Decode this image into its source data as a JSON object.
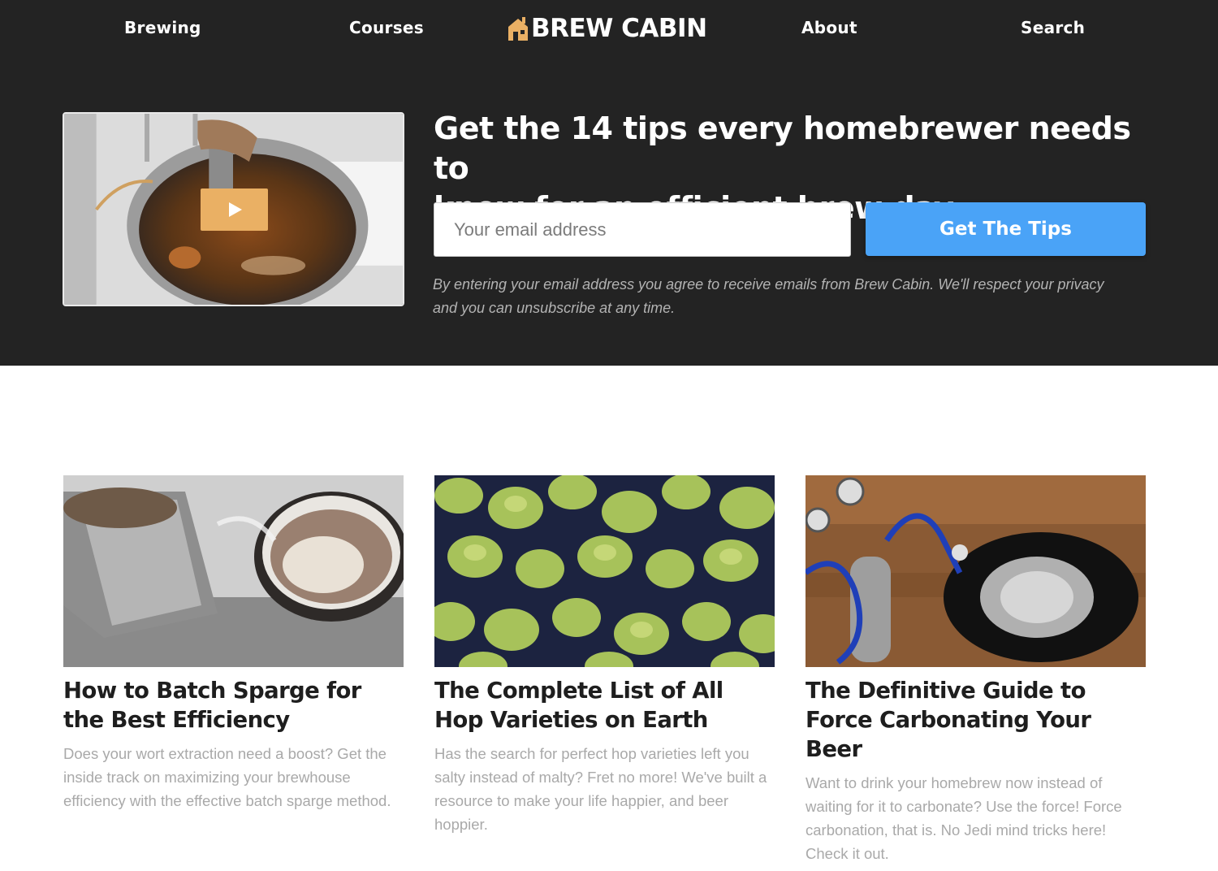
{
  "nav": {
    "links": [
      "Brewing",
      "Courses",
      "About",
      "Search"
    ],
    "logo_text": "BREW CABIN"
  },
  "hero": {
    "headline_line1": "Get the 14 tips every homebrewer needs to",
    "headline_line2": "know for an efficient brew day.",
    "email_placeholder": "Your email address",
    "cta_label": "Get The Tips",
    "disclaimer": "By entering your email address you agree to receive emails from Brew Cabin. We'll respect your privacy and you can unsubscribe at any time.",
    "play_icon": "play-icon",
    "accent_color": "#eab064",
    "cta_color": "#4aa3f7"
  },
  "articles": [
    {
      "title": "How to Batch Sparge for the Best Efficiency",
      "description": "Does your wort extraction need a boost? Get the inside track on maximizing your brewhouse efficiency with the effective batch sparge method."
    },
    {
      "title": "The Complete List of All Hop Varieties on Earth",
      "description": "Has the search for perfect hop varieties left you salty instead of malty? Fret no more! We've built a resource to make your life happier, and beer hoppier."
    },
    {
      "title": "The Definitive Guide to Force Carbonating Your Beer",
      "description": "Want to drink your homebrew now instead of waiting for it to carbonate? Use the force! Force carbonation, that is. No Jedi mind tricks here! Check it out."
    }
  ]
}
